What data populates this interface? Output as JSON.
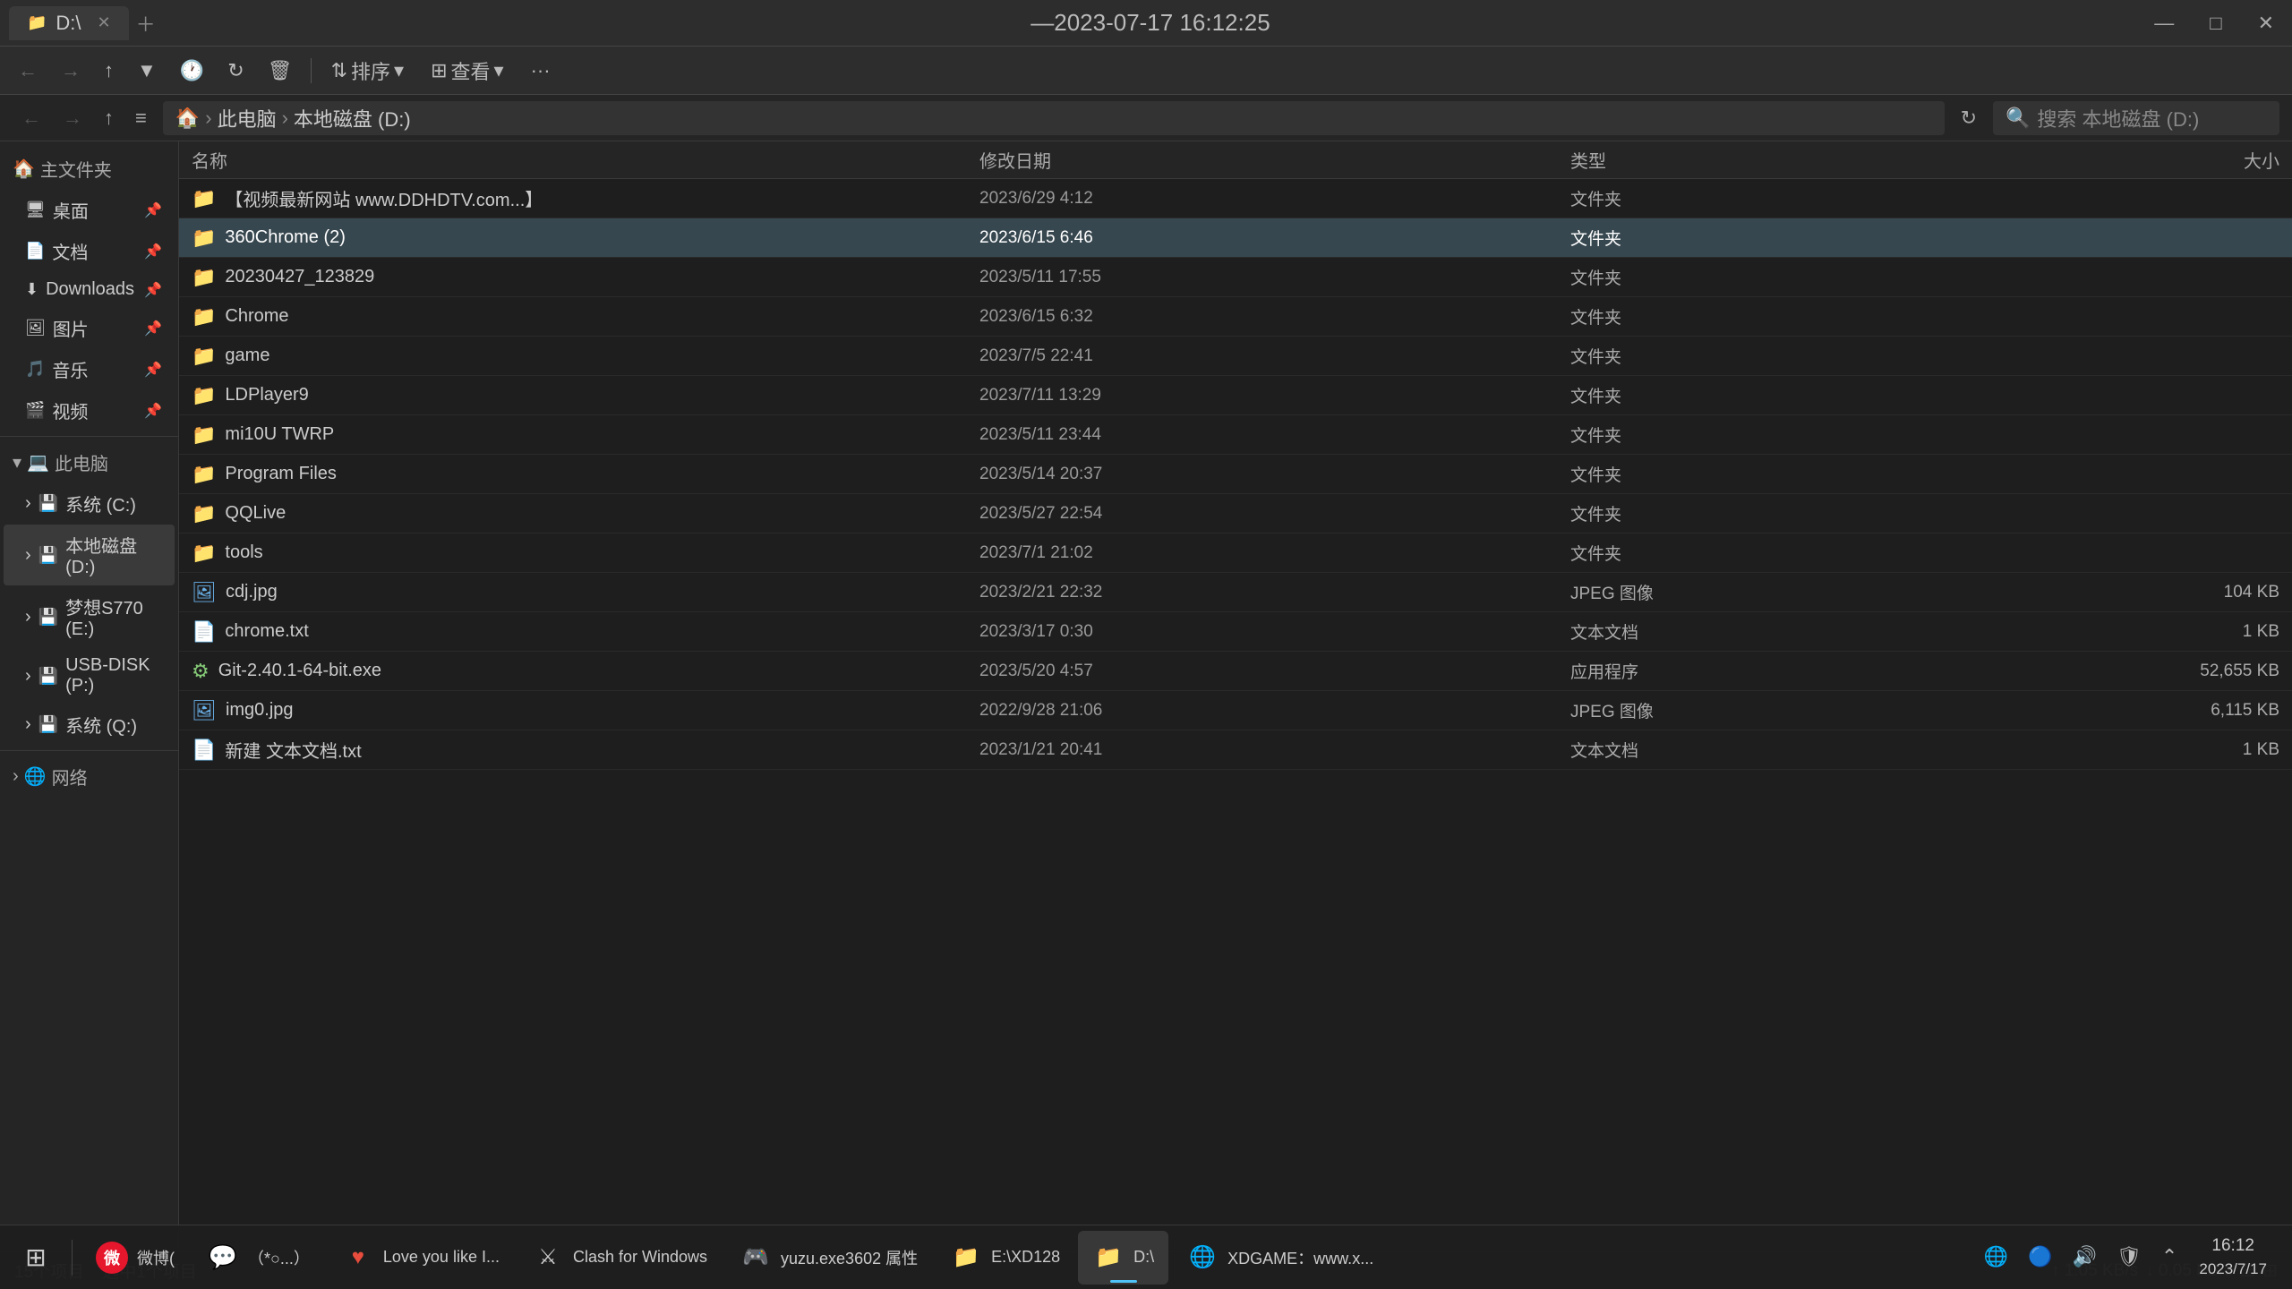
{
  "window": {
    "tab_label": "D:\\",
    "tab_icon": "📁",
    "title": "—2023-07-17 16:12:25",
    "controls": {
      "minimize": "—",
      "maximize": "□",
      "close": "✕"
    }
  },
  "toolbar": {
    "back": "←",
    "forward": "→",
    "up": "↑",
    "history": "▾",
    "recent": "🕐",
    "refresh": "↻",
    "delete": "🗑",
    "sort_label": "排序",
    "view_label": "查看",
    "more": "···"
  },
  "address": {
    "path_parts": [
      "此电脑",
      "本地磁盘 (D:)"
    ],
    "search_placeholder": "搜索 本地磁盘 (D:)"
  },
  "sidebar": {
    "quick_access_label": "主文件夹",
    "items": [
      {
        "label": "桌面",
        "icon": "🖥",
        "pin": true
      },
      {
        "label": "文档",
        "icon": "📄",
        "pin": true
      },
      {
        "label": "Downloads",
        "icon": "⬇",
        "pin": true
      },
      {
        "label": "图片",
        "icon": "🖼",
        "pin": true
      },
      {
        "label": "音乐",
        "icon": "🎵",
        "pin": true
      },
      {
        "label": "视频",
        "icon": "🎬",
        "pin": true
      }
    ],
    "this_pc_label": "此电脑",
    "drives": [
      {
        "label": "系统 (C:)",
        "icon": "💾"
      },
      {
        "label": "本地磁盘 (D:)",
        "icon": "💾",
        "active": true
      },
      {
        "label": "梦想S770 (E:)",
        "icon": "💾"
      },
      {
        "label": "USB-DISK (P:)",
        "icon": "💾"
      },
      {
        "label": "系统 (Q:)",
        "icon": "💾"
      }
    ],
    "network_label": "网络"
  },
  "file_list": {
    "columns": {
      "name": "名称",
      "date": "修改日期",
      "type": "类型",
      "size": "大小"
    },
    "items": [
      {
        "name": "【视频最新网站 www.DDHDTV.com...】",
        "date": "2023/6/29 4:12",
        "type": "文件夹",
        "size": "",
        "icon_type": "folder",
        "selected": false
      },
      {
        "name": "360Chrome (2)",
        "date": "2023/6/15 6:46",
        "type": "文件夹",
        "size": "",
        "icon_type": "folder",
        "selected": true
      },
      {
        "name": "20230427_123829",
        "date": "2023/5/11 17:55",
        "type": "文件夹",
        "size": "",
        "icon_type": "folder",
        "selected": false
      },
      {
        "name": "Chrome",
        "date": "2023/6/15 6:32",
        "type": "文件夹",
        "size": "",
        "icon_type": "folder",
        "selected": false
      },
      {
        "name": "game",
        "date": "2023/7/5 22:41",
        "type": "文件夹",
        "size": "",
        "icon_type": "folder",
        "selected": false
      },
      {
        "name": "LDPlayer9",
        "date": "2023/7/11 13:29",
        "type": "文件夹",
        "size": "",
        "icon_type": "folder",
        "selected": false
      },
      {
        "name": "mi10U TWRP",
        "date": "2023/5/11 23:44",
        "type": "文件夹",
        "size": "",
        "icon_type": "folder",
        "selected": false
      },
      {
        "name": "Program Files",
        "date": "2023/5/14 20:37",
        "type": "文件夹",
        "size": "",
        "icon_type": "folder",
        "selected": false
      },
      {
        "name": "QQLive",
        "date": "2023/5/27 22:54",
        "type": "文件夹",
        "size": "",
        "icon_type": "folder",
        "selected": false
      },
      {
        "name": "tools",
        "date": "2023/7/1 21:02",
        "type": "文件夹",
        "size": "",
        "icon_type": "folder",
        "selected": false
      },
      {
        "name": "cdj.jpg",
        "date": "2023/2/21 22:32",
        "type": "JPEG 图像",
        "size": "104 KB",
        "icon_type": "image",
        "selected": false
      },
      {
        "name": "chrome.txt",
        "date": "2023/3/17 0:30",
        "type": "文本文档",
        "size": "1 KB",
        "icon_type": "text",
        "selected": false
      },
      {
        "name": "Git-2.40.1-64-bit.exe",
        "date": "2023/5/20 4:57",
        "type": "应用程序",
        "size": "52,655 KB",
        "icon_type": "exe",
        "selected": false
      },
      {
        "name": "img0.jpg",
        "date": "2022/9/28 21:06",
        "type": "JPEG 图像",
        "size": "6,115 KB",
        "icon_type": "image",
        "selected": false
      },
      {
        "name": "新建 文本文档.txt",
        "date": "2023/1/21 20:41",
        "type": "文本文档",
        "size": "1 KB",
        "icon_type": "text",
        "selected": false
      }
    ]
  },
  "status_bar": {
    "item_count": "15个项目",
    "selected_count": "选中1个项目",
    "network_speed": "↑ 1.05 KB/s",
    "network_speed2": "↓ 0.05 KB/s"
  },
  "taskbar": {
    "start_icon": "⊞",
    "apps": [
      {
        "label": "微博",
        "icon": "微",
        "active": false
      },
      {
        "label": "（*○...）",
        "icon": "💬",
        "active": false
      },
      {
        "label": "Love you like I...",
        "icon": "❤",
        "active": false
      },
      {
        "label": "Clash for Windows",
        "icon": "⚔",
        "active": false
      },
      {
        "label": "yuzu.exe3602 属性",
        "icon": "🎮",
        "active": false
      },
      {
        "label": "E:\\XD128",
        "icon": "📁",
        "active": false
      },
      {
        "label": "D:\\",
        "icon": "📁",
        "active": true
      },
      {
        "label": "XDGAME：www.x...",
        "icon": "🌐",
        "active": false
      }
    ],
    "tray": {
      "network": "🌐",
      "bluetooth": "🔵",
      "volume": "🔊",
      "antivirus": "🛡",
      "time": "16:12",
      "date": "2023/7/17"
    }
  }
}
